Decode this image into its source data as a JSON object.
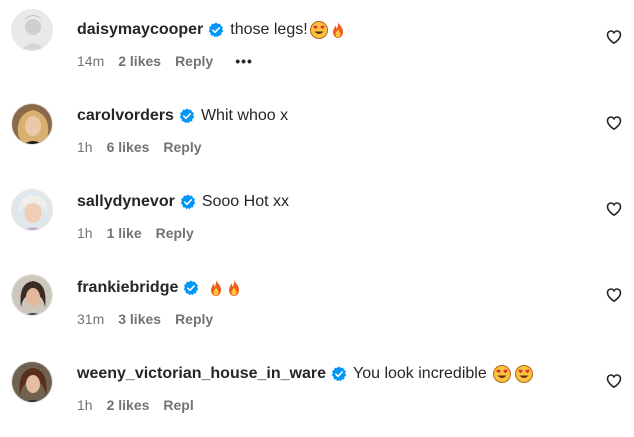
{
  "comments": [
    {
      "username": "daisymaycooper",
      "text": "those legs!",
      "emojis": [
        "heart-eyes",
        "fire"
      ],
      "time": "14m",
      "likes": "2 likes",
      "reply": "Reply",
      "more": "•••"
    },
    {
      "username": "carolvorders",
      "text": "Whit whoo x",
      "emojis": [],
      "time": "1h",
      "likes": "6 likes",
      "reply": "Reply"
    },
    {
      "username": "sallydynevor",
      "text": "Sooo Hot xx",
      "emojis": [],
      "time": "1h",
      "likes": "1 like",
      "reply": "Reply"
    },
    {
      "username": "frankiebridge",
      "text": "",
      "emojis": [
        "fire",
        "fire"
      ],
      "time": "31m",
      "likes": "3 likes",
      "reply": "Reply"
    },
    {
      "username": "weeny_victorian_house_in_ware",
      "text": "You look incredible",
      "emojis": [
        "heart-eyes",
        "heart-eyes"
      ],
      "time": "1h",
      "likes": "2 likes",
      "reply": "Repl"
    }
  ],
  "colors": {
    "verified": "#0095f6",
    "meta": "#737373",
    "text": "#262626"
  },
  "icons": {
    "verified": "verified-badge-icon",
    "like": "heart-outline-icon",
    "more": "more-options-icon"
  }
}
